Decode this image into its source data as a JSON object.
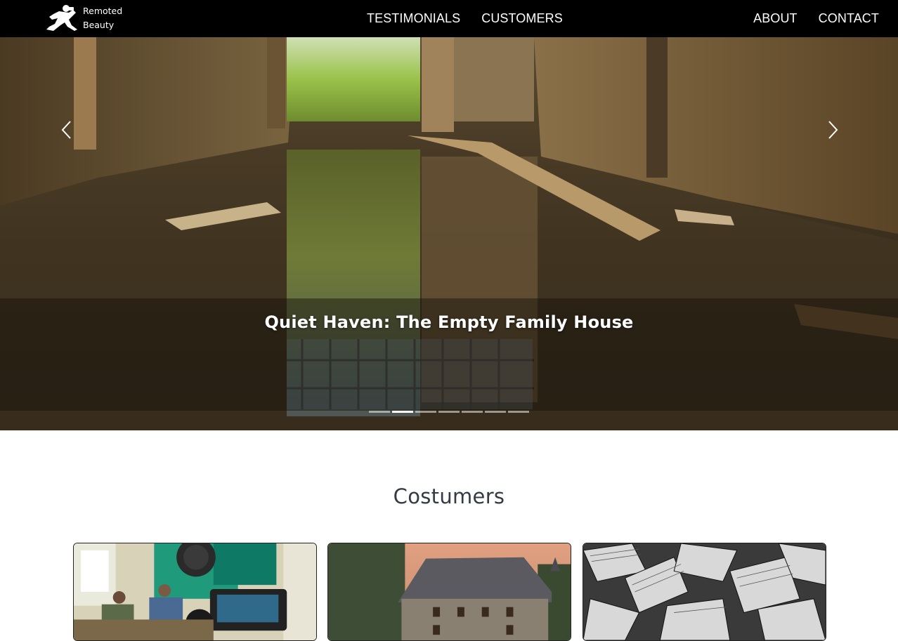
{
  "brand": {
    "name_line1": "Remoted",
    "name_line2": "Beauty",
    "logo_icon": "photographer-silhouette-icon"
  },
  "nav": {
    "center": [
      "TESTIMONIALS",
      "CUSTOMERS"
    ],
    "right": [
      "ABOUT",
      "CONTACT"
    ]
  },
  "carousel": {
    "caption": "Quiet Haven: The Empty Family House",
    "prev_icon": "chevron-left-icon",
    "next_icon": "chevron-right-icon",
    "slide_count": 7,
    "active_index": 1
  },
  "section": {
    "title": "Costumers"
  },
  "cards": [
    {
      "image": "office-video-shoot-photo"
    },
    {
      "image": "old-stone-house-photo"
    },
    {
      "image": "black-white-books-photo"
    }
  ],
  "colors": {
    "navbar": "#000000",
    "title": "#333b44",
    "accent_white": "#ffffff"
  }
}
